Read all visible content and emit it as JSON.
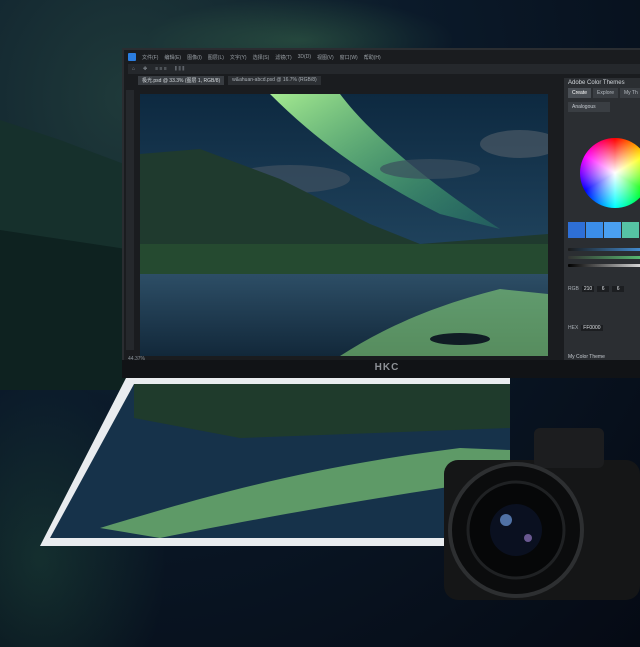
{
  "monitor": {
    "brand": "HKC",
    "menu": [
      "文件(F)",
      "编辑(E)",
      "图像(I)",
      "图层(L)",
      "文字(Y)",
      "选择(S)",
      "滤镜(T)",
      "3D(D)",
      "视图(V)",
      "窗口(W)",
      "帮助(H)"
    ],
    "tabs": [
      {
        "label": "极光.psd @ 33.3% (图层 1, RGB/8)",
        "active": true
      },
      {
        "label": "w&ahuan-abcd.psd @ 16.7% (RGB/8)",
        "active": false
      }
    ],
    "status_zoom": "44.37%"
  },
  "color_panel": {
    "title": "Adobe Color Themes",
    "tabs": [
      "Create",
      "Explore",
      "My Th"
    ],
    "rule": "Analogous",
    "rgb_label": "RGB",
    "rgb_values": [
      "210",
      "6",
      "6"
    ],
    "hex_label": "HEX",
    "hex_value": "FF0000",
    "theme_label": "My Color Theme",
    "swatch_colors": [
      "#2e6fd6",
      "#3b8de8",
      "#4a9ff0",
      "#56c2a4",
      "#5dd07a"
    ]
  }
}
